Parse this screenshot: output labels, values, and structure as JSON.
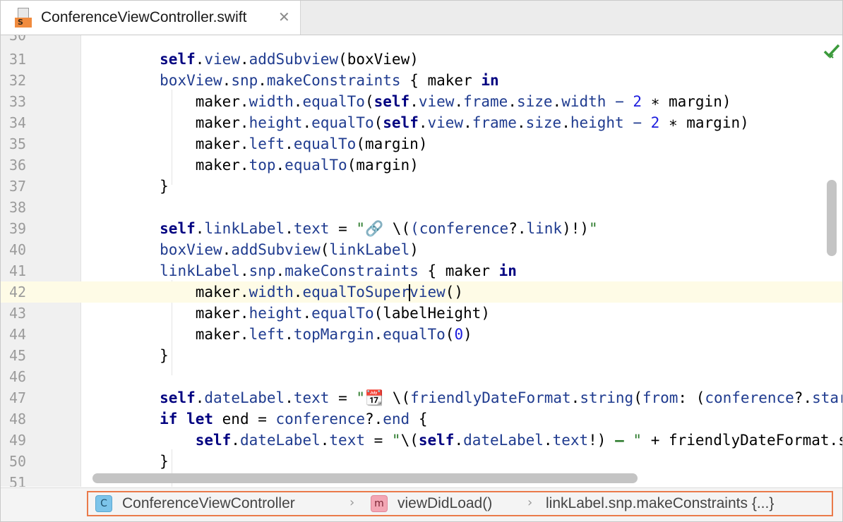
{
  "tab": {
    "file_badge": "S",
    "title": "ConferenceViewController.swift",
    "close_glyph": "✕",
    "icon": "swift-file-icon"
  },
  "editor": {
    "line_numbers": [
      "30",
      "31",
      "32",
      "33",
      "34",
      "35",
      "36",
      "37",
      "38",
      "39",
      "40",
      "41",
      "42",
      "43",
      "44",
      "45",
      "46",
      "47",
      "48",
      "49",
      "50",
      "51"
    ],
    "current_line": "42",
    "inspection_status_icon": "check-mark-icon",
    "colors": {
      "keyword": "#000080",
      "property": "#1f3b8f",
      "string": "#2b7a2b",
      "number": "#1d1dde",
      "current_line_bg": "#fefbe6"
    }
  },
  "breadcrumbs": {
    "items": [
      {
        "kind": "class",
        "badge": "C",
        "label": "ConferenceViewController"
      },
      {
        "kind": "method",
        "badge": "m",
        "label": "viewDidLoad()"
      },
      {
        "kind": "closure",
        "badge": "",
        "label": "linkLabel.snp.makeConstraints {...}"
      }
    ],
    "separator": "›",
    "highlight_color": "#ea7a4a"
  }
}
